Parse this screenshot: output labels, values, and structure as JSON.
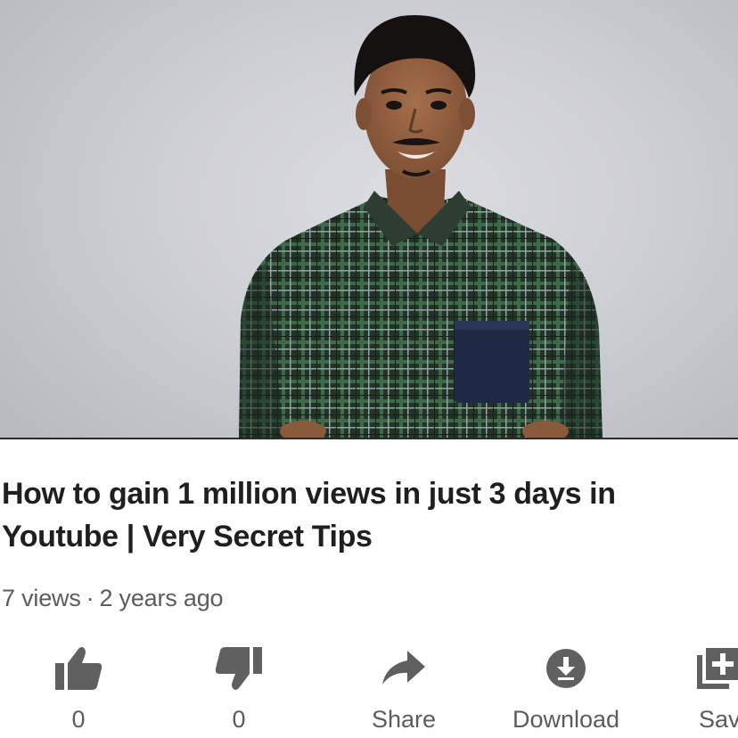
{
  "video": {
    "title": "How to gain 1 million views in just 3 days in Youtube | Very Secret Tips",
    "views": "7 views",
    "separator": "·",
    "age": "2 years ago"
  },
  "actions": {
    "like": {
      "icon": "thumbs-up-icon",
      "label": "0"
    },
    "dislike": {
      "icon": "thumbs-down-icon",
      "label": "0"
    },
    "share": {
      "icon": "share-arrow-icon",
      "label": "Share"
    },
    "download": {
      "icon": "download-icon",
      "label": "Download"
    },
    "save": {
      "icon": "add-to-playlist-icon",
      "label": "Sav"
    }
  },
  "colors": {
    "title_text": "#1f1f1f",
    "meta_text": "#5c5c5c",
    "icon_gray": "#606060",
    "background": "#ffffff"
  }
}
